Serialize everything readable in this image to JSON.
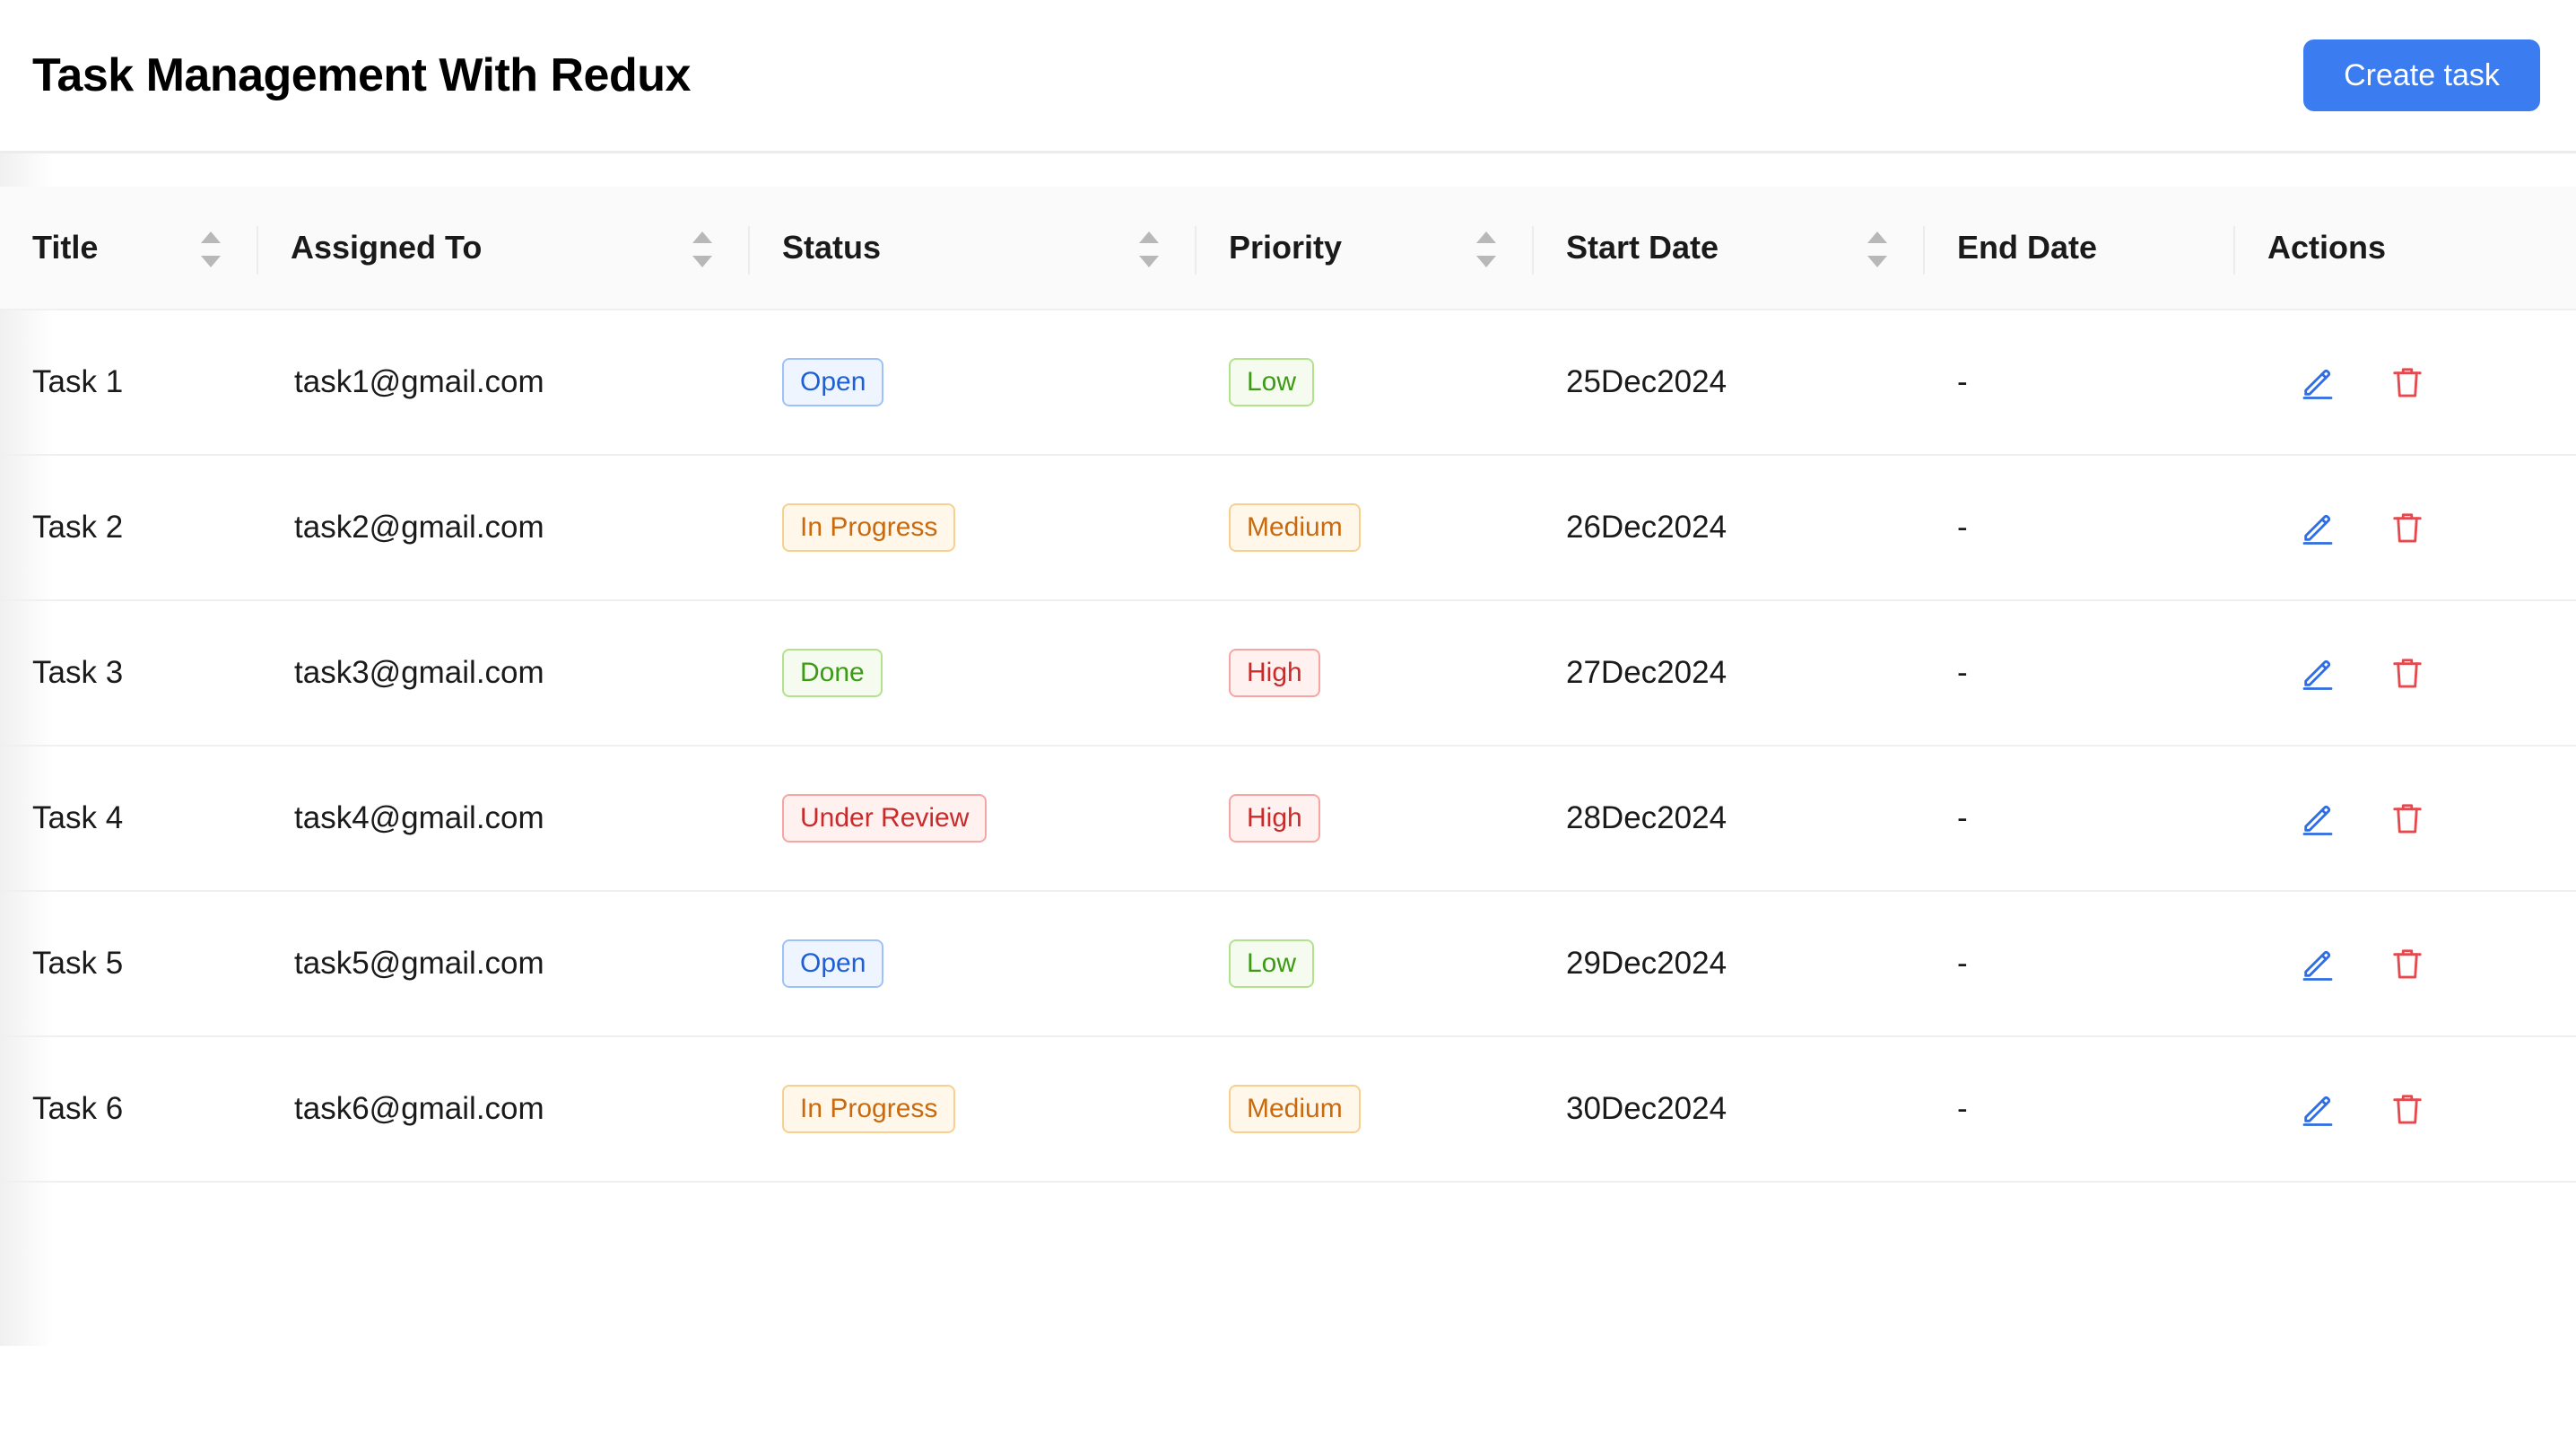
{
  "header": {
    "title": "Task Management With Redux",
    "create_label": "Create task"
  },
  "table": {
    "columns": [
      "Title",
      "Assigned To",
      "Status",
      "Priority",
      "Start Date",
      "End Date",
      "Actions"
    ],
    "rows": [
      {
        "title": "Task 1",
        "assigned": "task1@gmail.com",
        "status": "Open",
        "priority": "Low",
        "start": "25Dec2024",
        "end": "-"
      },
      {
        "title": "Task 2",
        "assigned": "task2@gmail.com",
        "status": "In Progress",
        "priority": "Medium",
        "start": "26Dec2024",
        "end": "-"
      },
      {
        "title": "Task 3",
        "assigned": "task3@gmail.com",
        "status": "Done",
        "priority": "High",
        "start": "27Dec2024",
        "end": "-"
      },
      {
        "title": "Task 4",
        "assigned": "task4@gmail.com",
        "status": "Under Review",
        "priority": "High",
        "start": "28Dec2024",
        "end": "-"
      },
      {
        "title": "Task 5",
        "assigned": "task5@gmail.com",
        "status": "Open",
        "priority": "Low",
        "start": "29Dec2024",
        "end": "-"
      },
      {
        "title": "Task 6",
        "assigned": "task6@gmail.com",
        "status": "In Progress",
        "priority": "Medium",
        "start": "30Dec2024",
        "end": "-"
      }
    ]
  },
  "icons": {
    "edit": "pencil-edit-icon",
    "delete": "trash-delete-icon",
    "sort": "sort-caret-icon"
  },
  "colors": {
    "primary": "#3b7cf0",
    "edit": "#2f6de0",
    "delete": "#e5484d"
  }
}
